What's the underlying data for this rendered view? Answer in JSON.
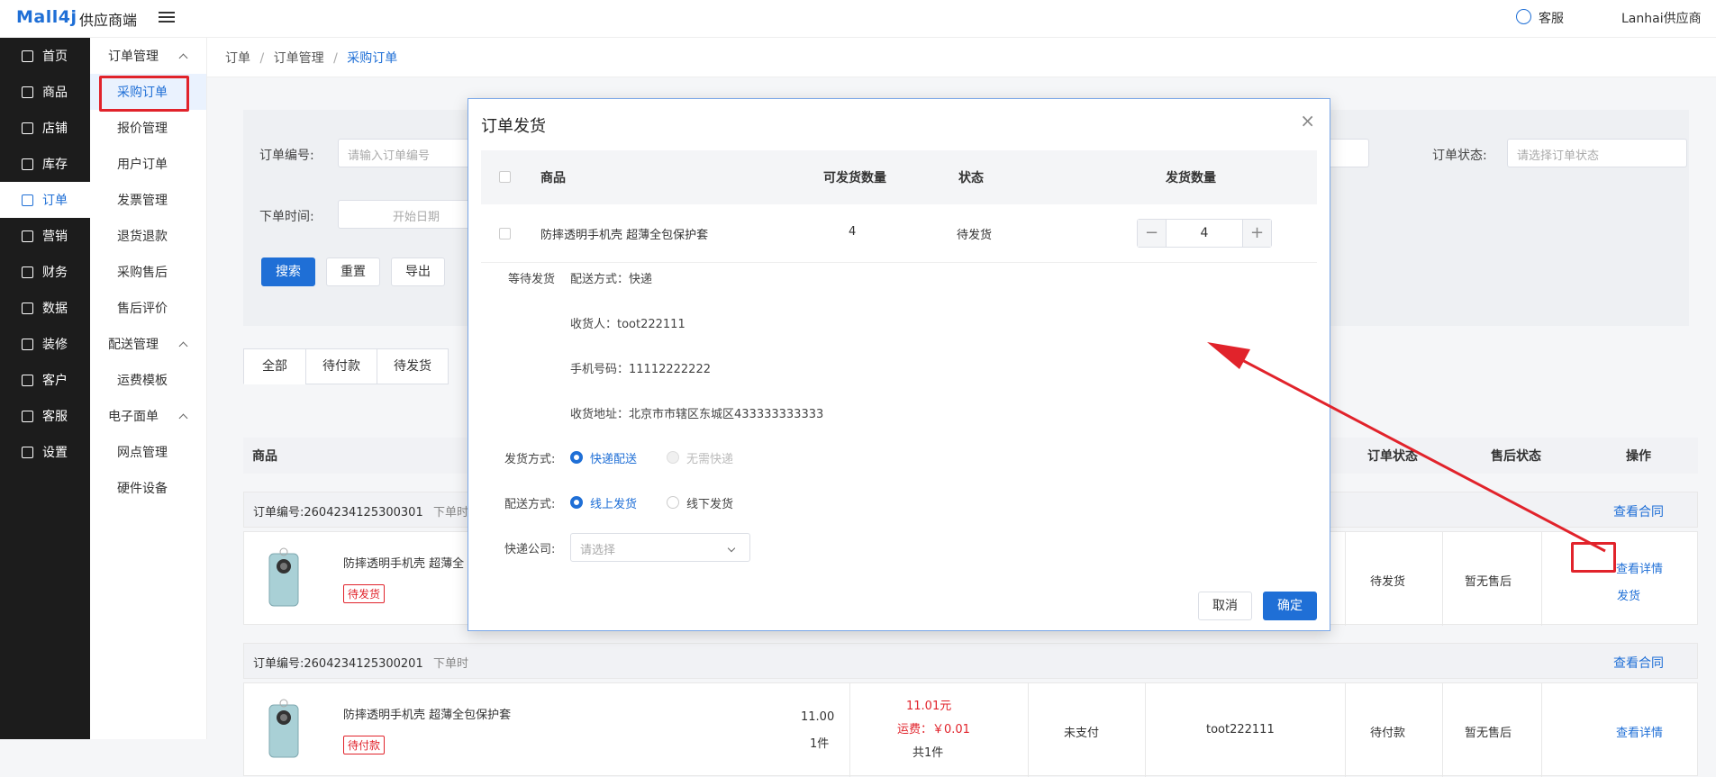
{
  "topbar": {
    "logo": "Mall4j",
    "logo_sub": "供应商端",
    "service": "客服",
    "user": "Lanhai供应商"
  },
  "sidebar": {
    "items": [
      {
        "label": "首页"
      },
      {
        "label": "商品"
      },
      {
        "label": "店铺"
      },
      {
        "label": "库存"
      },
      {
        "label": "订单",
        "active": true
      },
      {
        "label": "营销"
      },
      {
        "label": "财务"
      },
      {
        "label": "数据"
      },
      {
        "label": "装修"
      },
      {
        "label": "客户"
      },
      {
        "label": "客服"
      },
      {
        "label": "设置"
      }
    ]
  },
  "submenu": {
    "group1": "订单管理",
    "g1_items": [
      "采购订单",
      "报价管理",
      "用户订单",
      "发票管理",
      "退货退款",
      "采购售后",
      "售后评价"
    ],
    "group2": "配送管理",
    "g2_items": [
      "运费模板"
    ],
    "group3": "电子面单",
    "g3_items": [
      "网点管理",
      "硬件设备"
    ]
  },
  "breadcrumb": {
    "b1": "订单",
    "b2": "订单管理",
    "b3": "采购订单",
    "sep": "/"
  },
  "filters": {
    "order_no_label": "订单编号:",
    "order_no_placeholder": "请输入订单编号",
    "order_time_label": "下单时间:",
    "start_date": "开始日期",
    "status_label": "订单状态:",
    "status_placeholder": "请选择订单状态",
    "search": "搜索",
    "reset": "重置",
    "export": "导出"
  },
  "tabs": [
    "全部",
    "待付款",
    "待发货"
  ],
  "table": {
    "product": "商品",
    "order_status": "订单状态",
    "after_sale": "售后状态",
    "action": "操作"
  },
  "orders": [
    {
      "order_no": "订单编号:2604234125300301",
      "order_time_prefix": "下单时",
      "contract": "查看合同",
      "product": "防摔透明手机壳 超薄全",
      "tag": "待发货",
      "status": "待发货",
      "after": "暂无售后",
      "detail": "查看详情",
      "ship": "发货"
    },
    {
      "order_no": "订单编号:2604234125300201",
      "order_time_prefix": "下单时",
      "contract": "查看合同",
      "product": "防摔透明手机壳 超薄全包保护套",
      "tag": "待付款",
      "price": "11.00",
      "qty": "1件",
      "total": "11.01元",
      "freight": "运费：￥0.01",
      "count": "共1件",
      "pay": "未支付",
      "buyer": "toot222111",
      "status": "待付款",
      "after": "暂无售后",
      "detail": "查看详情"
    }
  ],
  "modal": {
    "title": "订单发货",
    "close": "×",
    "head": {
      "product": "商品",
      "available": "可发货数量",
      "state": "状态",
      "qty": "发货数量"
    },
    "row": {
      "product": "防摔透明手机壳 超薄全包保护套",
      "available": "4",
      "state": "待发货",
      "qty": "4",
      "minus": "−",
      "plus": "+"
    },
    "waiting": "等待发货",
    "delivery": "配送方式：快递",
    "receiver": "收货人：toot222111",
    "mobile": "手机号码：11112222222",
    "address": "收货地址：北京市市辖区东城区433333333333",
    "ship_method_label": "发货方式:",
    "ship_opt1": "快递配送",
    "ship_opt2": "无需快递",
    "dispatch_label": "配送方式:",
    "dispatch_opt1": "线上发货",
    "dispatch_opt2": "线下发货",
    "courier_label": "快递公司:",
    "courier_placeholder": "请选择",
    "cancel": "取消",
    "confirm": "确定"
  },
  "colors": {
    "accent": "#1f6fd6",
    "highlight": "#e1232b",
    "sidebar": "#1c1c1c"
  }
}
